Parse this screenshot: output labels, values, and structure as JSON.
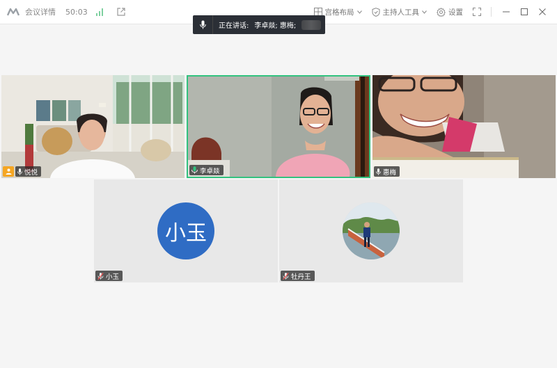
{
  "topbar": {
    "meeting_info_label": "会议详情",
    "duration": "50:03",
    "layout_label": "宫格布局",
    "host_tools_label": "主持人工具",
    "settings_label": "设置"
  },
  "speaking_banner": {
    "label": "正在讲话:",
    "speakers": "李卓燚; 惠梅;"
  },
  "participants": [
    {
      "name": "悦悦"
    },
    {
      "name": "李卓燚"
    },
    {
      "name": "惠梅"
    },
    {
      "name": "小玉",
      "avatar_text": "小玉"
    },
    {
      "name": "牡丹王"
    }
  ],
  "colors": {
    "active_speaker_border": "#32c27f",
    "avatar_blue": "#2f6cc4",
    "host_badge": "#f5a623"
  }
}
